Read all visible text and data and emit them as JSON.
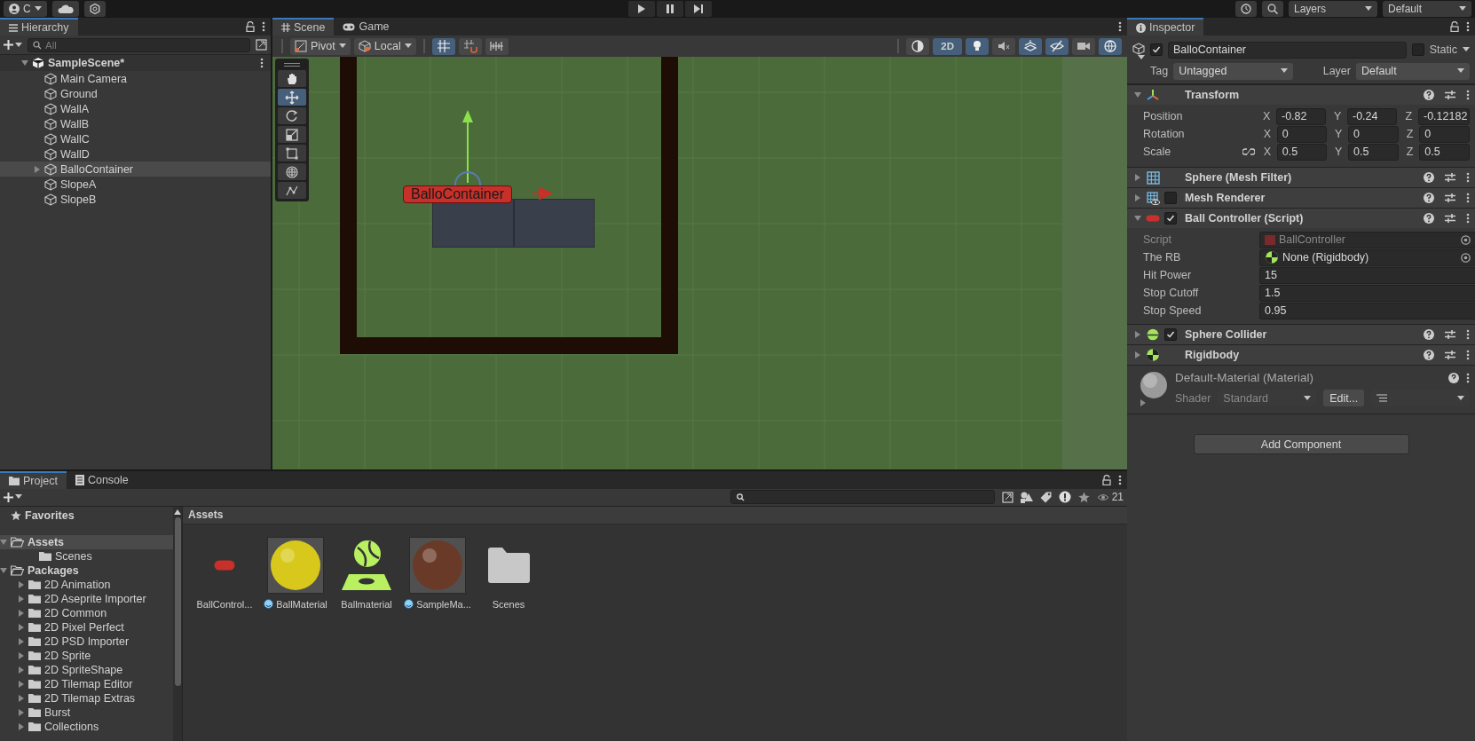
{
  "toolbar": {
    "account": "C",
    "layers": "Layers",
    "layout": "Default"
  },
  "hierarchy": {
    "title": "Hierarchy",
    "search_placeholder": "All",
    "scene": {
      "name": "SampleScene*",
      "expanded": true,
      "children": [
        {
          "name": "Main Camera",
          "selected": false
        },
        {
          "name": "Ground",
          "selected": false
        },
        {
          "name": "WallA",
          "selected": false
        },
        {
          "name": "WallB",
          "selected": false
        },
        {
          "name": "WallC",
          "selected": false
        },
        {
          "name": "WallD",
          "selected": false
        },
        {
          "name": "BalloContainer",
          "selected": true,
          "expanded": false
        },
        {
          "name": "SlopeA",
          "selected": false
        },
        {
          "name": "SlopeB",
          "selected": false
        }
      ]
    }
  },
  "scene_view": {
    "tabs": [
      {
        "label": "Scene",
        "kind": "scene",
        "selected": true
      },
      {
        "label": "Game",
        "kind": "game",
        "selected": false
      }
    ],
    "pivot": "Pivot",
    "space": "Local",
    "snap_buttons": [
      {
        "kind": "grid",
        "on": true
      },
      {
        "kind": "increment",
        "on": false
      },
      {
        "kind": "settings",
        "on": false
      }
    ],
    "view_buttons": [
      {
        "kind": "shading",
        "on": false
      },
      {
        "kind": "dimension",
        "label": "2D",
        "on": true
      },
      {
        "kind": "light",
        "on": true
      },
      {
        "kind": "audio",
        "on": false
      },
      {
        "kind": "effects",
        "on": true
      },
      {
        "kind": "visibility",
        "on": true
      },
      {
        "kind": "camera",
        "on": false
      },
      {
        "kind": "gizmos",
        "on": true
      }
    ],
    "tools": [
      {
        "kind": "hand",
        "selected": false
      },
      {
        "kind": "move",
        "selected": true
      },
      {
        "kind": "rotate",
        "selected": false
      },
      {
        "kind": "scale",
        "selected": false
      },
      {
        "kind": "rect",
        "selected": false
      },
      {
        "kind": "transform",
        "selected": false
      },
      {
        "kind": "custom",
        "selected": false
      }
    ],
    "object_label": "BalloContainer"
  },
  "inspector": {
    "title": "Inspector",
    "object": {
      "name": "BalloContainer",
      "active": true,
      "static": false,
      "static_label": "Static",
      "tag_label": "Tag",
      "tag": "Untagged",
      "layer_label": "Layer",
      "layer": "Default"
    },
    "components": [
      {
        "kind": "transform",
        "name": "Transform",
        "expanded": true,
        "rows": [
          {
            "label": "Position",
            "values": [
              {
                "axis": "X",
                "value": "-0.82"
              },
              {
                "axis": "Y",
                "value": "-0.24"
              },
              {
                "axis": "Z",
                "value": "-0.12182"
              }
            ]
          },
          {
            "label": "Rotation",
            "values": [
              {
                "axis": "X",
                "value": "0"
              },
              {
                "axis": "Y",
                "value": "0"
              },
              {
                "axis": "Z",
                "value": "0"
              }
            ]
          },
          {
            "label": "Scale",
            "values": [
              {
                "axis": "X",
                "value": "0.5"
              },
              {
                "axis": "Y",
                "value": "0.5"
              },
              {
                "axis": "Z",
                "value": "0.5"
              }
            ]
          }
        ]
      },
      {
        "kind": "mesh_filter",
        "name": "Sphere (Mesh Filter)",
        "expanded": false
      },
      {
        "kind": "mesh_renderer",
        "name": "Mesh Renderer",
        "expanded": false,
        "enabled": false
      },
      {
        "kind": "script",
        "name": "Ball Controller (Script)",
        "expanded": true,
        "enabled": true,
        "fields": [
          {
            "label": "Script",
            "kind": "script_ref",
            "value": "BallController",
            "disabled": true
          },
          {
            "label": "The RB",
            "kind": "object_ref",
            "value": "None (Rigidbody)",
            "disabled": false
          },
          {
            "label": "Hit Power",
            "kind": "number",
            "value": "15",
            "disabled": false
          },
          {
            "label": "Stop Cutoff",
            "kind": "number",
            "value": "1.5",
            "disabled": false
          },
          {
            "label": "Stop Speed",
            "kind": "number",
            "value": "0.95",
            "disabled": false
          }
        ]
      },
      {
        "kind": "sphere_collider",
        "name": "Sphere Collider",
        "expanded": false,
        "enabled": true
      },
      {
        "kind": "rigidbody",
        "name": "Rigidbody",
        "expanded": false
      }
    ],
    "material": {
      "name": "Default-Material (Material)",
      "shader_label": "Shader",
      "shader": "Standard",
      "edit": "Edit..."
    },
    "add_component": "Add Component"
  },
  "project": {
    "tabs": [
      {
        "label": "Project",
        "kind": "project",
        "selected": true
      },
      {
        "label": "Console",
        "kind": "console",
        "selected": false
      }
    ],
    "count": "21",
    "tree": [
      {
        "label": "Favorites",
        "kind": "favorites",
        "selected": false
      },
      {
        "label": "Assets",
        "kind": "root",
        "expanded": true,
        "selected": true,
        "children": [
          {
            "label": "Scenes",
            "selected": false
          }
        ]
      },
      {
        "label": "Packages",
        "kind": "root",
        "expanded": true,
        "selected": false,
        "children": [
          {
            "label": "2D Animation",
            "expanded": false,
            "selected": false
          },
          {
            "label": "2D Aseprite Importer",
            "expanded": false,
            "selected": false
          },
          {
            "label": "2D Common",
            "expanded": false,
            "selected": false
          },
          {
            "label": "2D Pixel Perfect",
            "expanded": false,
            "selected": false
          },
          {
            "label": "2D PSD Importer",
            "expanded": false,
            "selected": false
          },
          {
            "label": "2D Sprite",
            "expanded": false,
            "selected": false
          },
          {
            "label": "2D SpriteShape",
            "expanded": false,
            "selected": false
          },
          {
            "label": "2D Tilemap Editor",
            "expanded": false,
            "selected": false
          },
          {
            "label": "2D Tilemap Extras",
            "expanded": false,
            "selected": false
          },
          {
            "label": "Burst",
            "expanded": false,
            "selected": false
          },
          {
            "label": "Collections",
            "expanded": false,
            "selected": false
          }
        ]
      }
    ],
    "breadcrumb": "Assets",
    "assets": [
      {
        "label": "BallControl...",
        "kind": "script"
      },
      {
        "label": "BallMaterial",
        "kind": "material",
        "color": "#d8c81c"
      },
      {
        "label": "Ballmaterial",
        "kind": "physics_material"
      },
      {
        "label": "SampleMa...",
        "kind": "material",
        "color": "#6a3a28"
      },
      {
        "label": "Scenes",
        "kind": "folder"
      }
    ]
  }
}
